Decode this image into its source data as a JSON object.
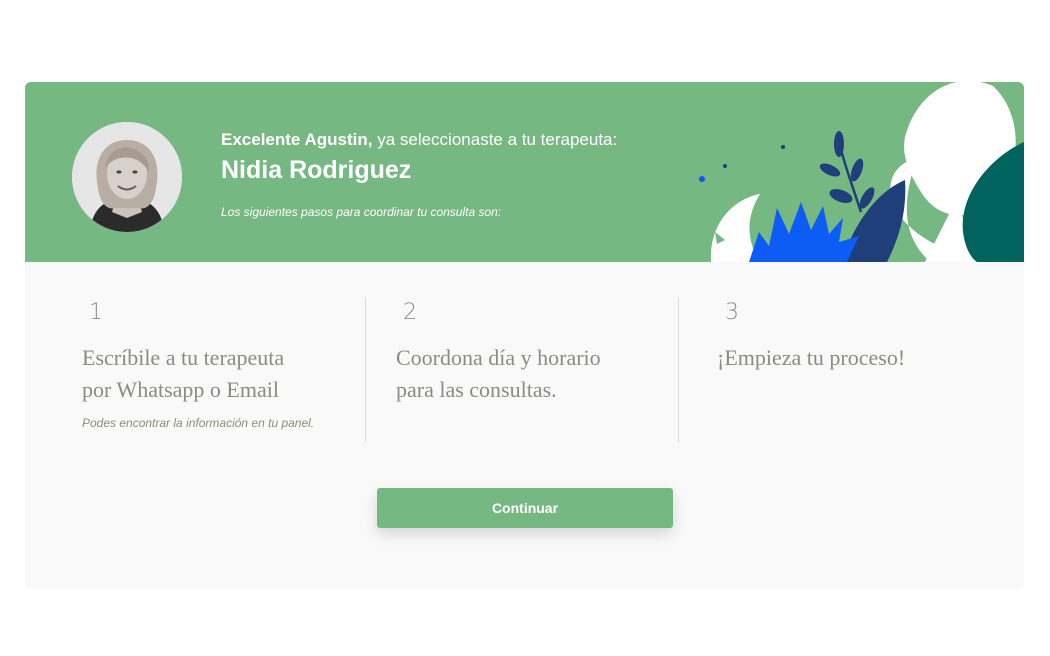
{
  "header": {
    "greeting_strong": "Excelente Agustin,",
    "greeting_rest": " ya seleccionaste a tu terapeuta:",
    "therapist_name": "Nidia Rodriguez",
    "steps_intro": "Los siguientes pasos para coordinar tu consulta son:"
  },
  "steps": [
    {
      "number": "1",
      "title_line1": "Escríbile a tu terapeuta",
      "title_line2": "por Whatsapp o Email",
      "note": "Podes encontrar la información en tu panel."
    },
    {
      "number": "2",
      "title_line1": "Coordona día y horario",
      "title_line2": "para las consultas."
    },
    {
      "number": "3",
      "title_line1": "¡Empieza tu proceso!"
    }
  ],
  "actions": {
    "continue_label": "Continuar"
  },
  "colors": {
    "accent_green": "#76b882",
    "dark_teal": "#00635d",
    "leaf_blue": "#0d5cf5",
    "leaf_navy": "#1f3f7a",
    "step_text": "#8b8b7f",
    "card_bg": "#f9f9f9"
  },
  "icons": [
    "therapist-avatar",
    "decorative-leaves-icon"
  ]
}
